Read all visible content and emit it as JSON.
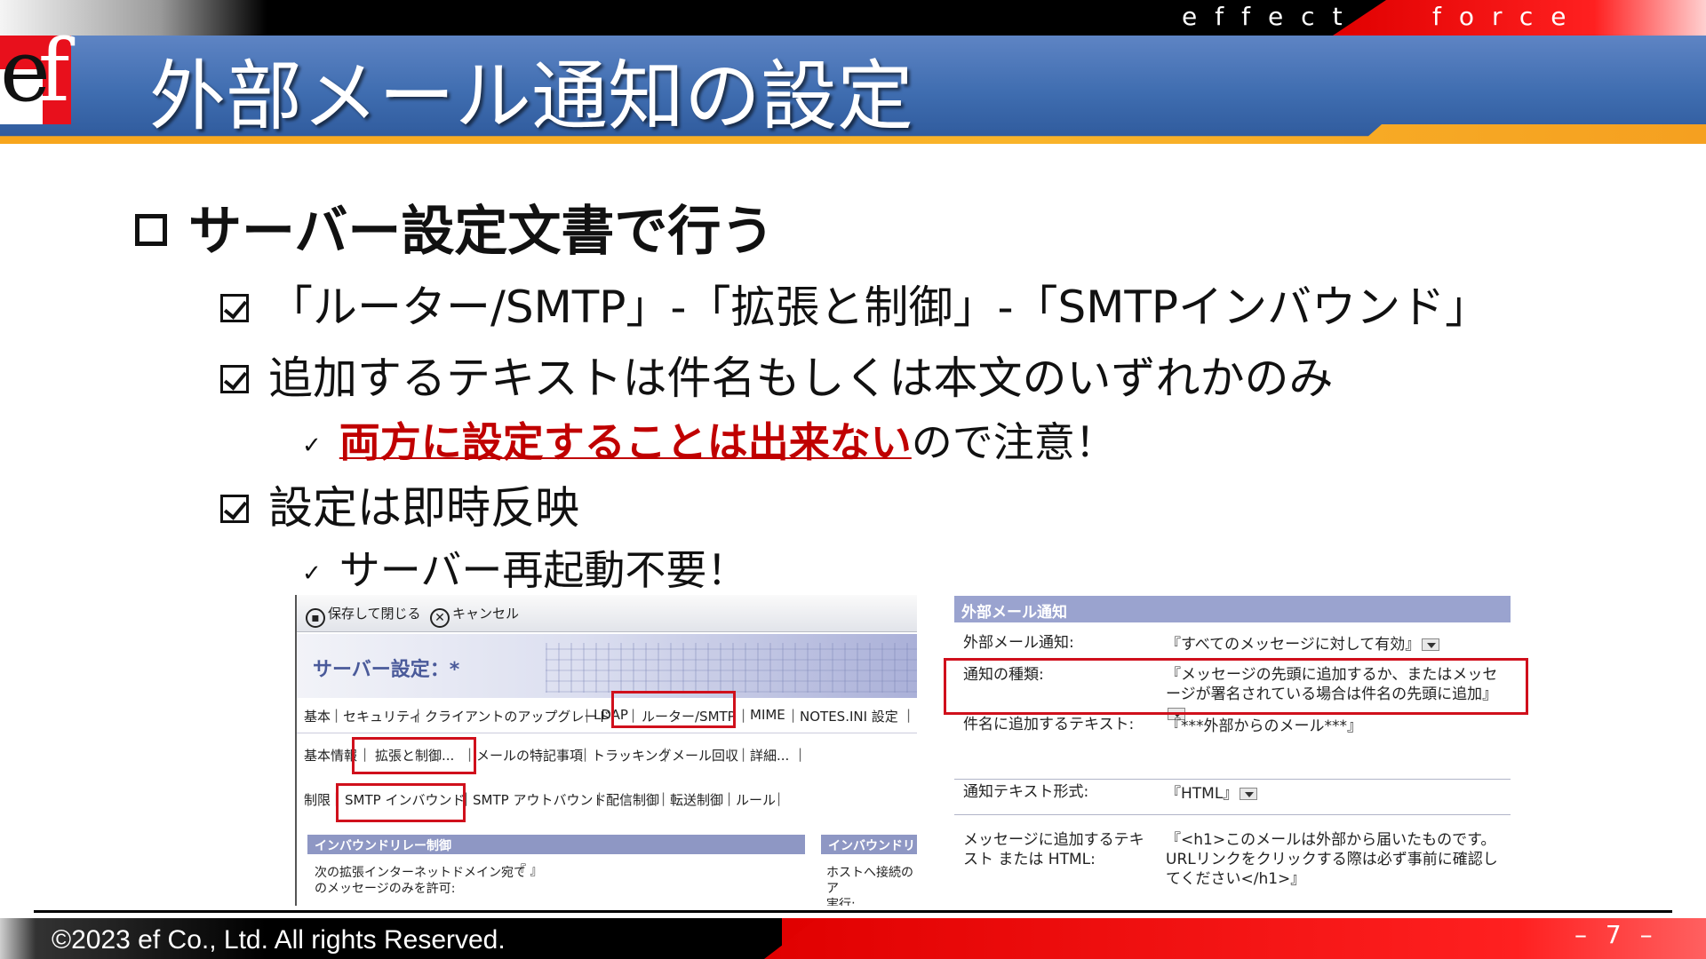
{
  "header": {
    "brand_left": "effect",
    "brand_right": "force",
    "logo": "ef",
    "title": "外部メール通知の設定"
  },
  "content": {
    "heading": "サーバー設定文書で行う",
    "bullets": [
      {
        "text": "「ルーター/SMTP」-「拡張と制御」-「SMTPインバウンド」"
      },
      {
        "text": "追加するテキストは件名もしくは本文のいずれかのみ"
      },
      {
        "sub_red": "両方に設定することは出来ない",
        "sub_rest": "ので注意！"
      },
      {
        "text": "設定は即時反映"
      },
      {
        "sub": "サーバー再起動不要！"
      }
    ]
  },
  "screenshot_left": {
    "toolbar": {
      "save": "保存して閉じる",
      "cancel": "キャンセル"
    },
    "doc_title": "サーバー設定：*",
    "tabs1": [
      "基本",
      "セキュリティ",
      "クライアントのアップグレード",
      "LDAP",
      "ルーター/SMTP",
      "MIME",
      "NOTES.INI 設定"
    ],
    "tabs2": [
      "基本情報",
      "拡張と制御...",
      "メールの特記事項",
      "トラッキング",
      "メール回収",
      "詳細..."
    ],
    "tabs3": [
      "制限",
      "SMTP インバウンド",
      "SMTP アウトバウンド",
      "配信制御",
      "転送制御",
      "ルール"
    ],
    "section_left": "インバウンドリレー制御",
    "section_right": "インバウンドリレー",
    "field_left_1": "次の拡張インターネットドメイン宛て",
    "field_left_2": "のメッセージのみを許可:",
    "field_left_value": "『 』",
    "field_right_1": "ホストへ接続のア",
    "field_right_2": "実行:"
  },
  "screenshot_right": {
    "header": "外部メール通知",
    "rows": [
      {
        "label": "外部メール通知:",
        "value": "『すべてのメッセージに対して有効』"
      },
      {
        "label": "通知の種類:",
        "value": "『メッセージの先頭に追加するか、またはメッセージが署名されている場合は件名の先頭に追加』"
      },
      {
        "label": "件名に追加するテキスト:",
        "value": "『***外部からのメール***』"
      },
      {
        "label": "通知テキスト形式:",
        "value": "『HTML』"
      },
      {
        "label": "メッセージに追加するテキスト または HTML:",
        "value": "『<h1>このメールは外部から届いたものです。URLリンクをクリックする際は必ず事前に確認してください</h1>』"
      }
    ]
  },
  "footer": {
    "copyright": "©2023 ef Co., Ltd.  All rights Reserved.",
    "page": "– 7 –"
  }
}
